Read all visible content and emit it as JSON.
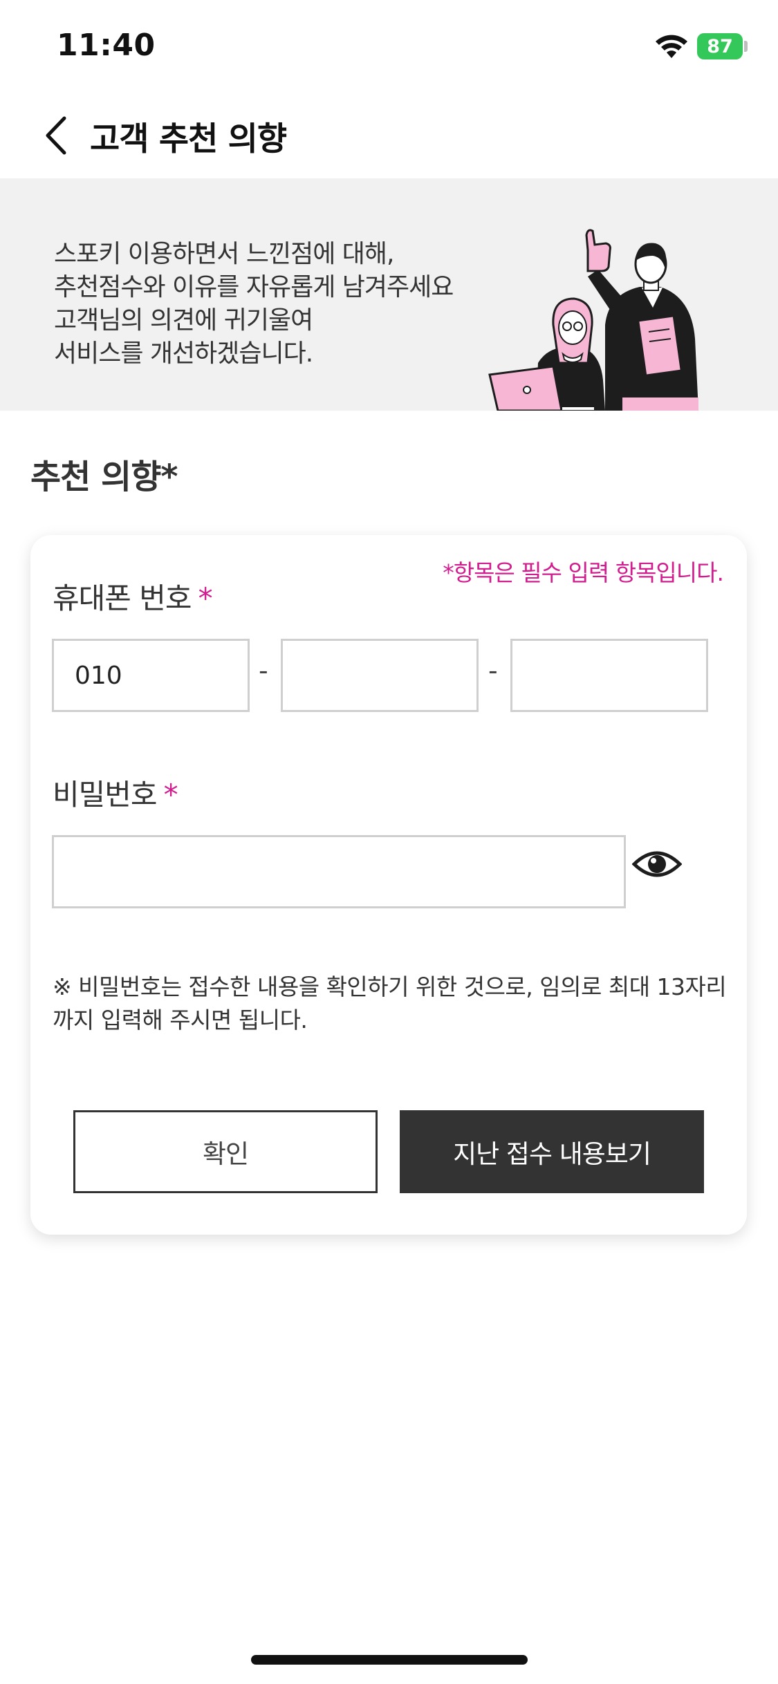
{
  "status_bar": {
    "time": "11:40",
    "battery": "87"
  },
  "nav": {
    "title": "고객 추천 의향"
  },
  "banner": {
    "lines": [
      "스포키 이용하면서 느낀점에 대해,",
      "추천점수와 이유를 자유롭게 남겨주세요",
      "고객님의 의견에 귀기울여",
      "서비스를 개선하겠습니다."
    ]
  },
  "section": {
    "title": "추천 의향*"
  },
  "form": {
    "required_note": "*항목은 필수 입력 항목입니다.",
    "phone": {
      "label": "휴대폰 번호",
      "star": "*",
      "part1": "010",
      "part2": "",
      "part3": "",
      "separator": "-"
    },
    "password": {
      "label": "비밀번호",
      "star": "*",
      "value": ""
    },
    "notice": "※ 비밀번호는 접수한 내용을 확인하기 위한 것으로, 임의로 최대 13자리까지 입력해 주시면 됩니다.",
    "confirm_label": "확인",
    "history_label": "지난 접수 내용보기"
  },
  "colors": {
    "accent": "#d21d8e",
    "dark_button": "#333333",
    "banner_bg": "#f1f1f1",
    "battery": "#34c759"
  },
  "icons": {
    "back": "chevron-left-icon",
    "password_toggle": "eye-icon",
    "wifi": "wifi-icon"
  }
}
